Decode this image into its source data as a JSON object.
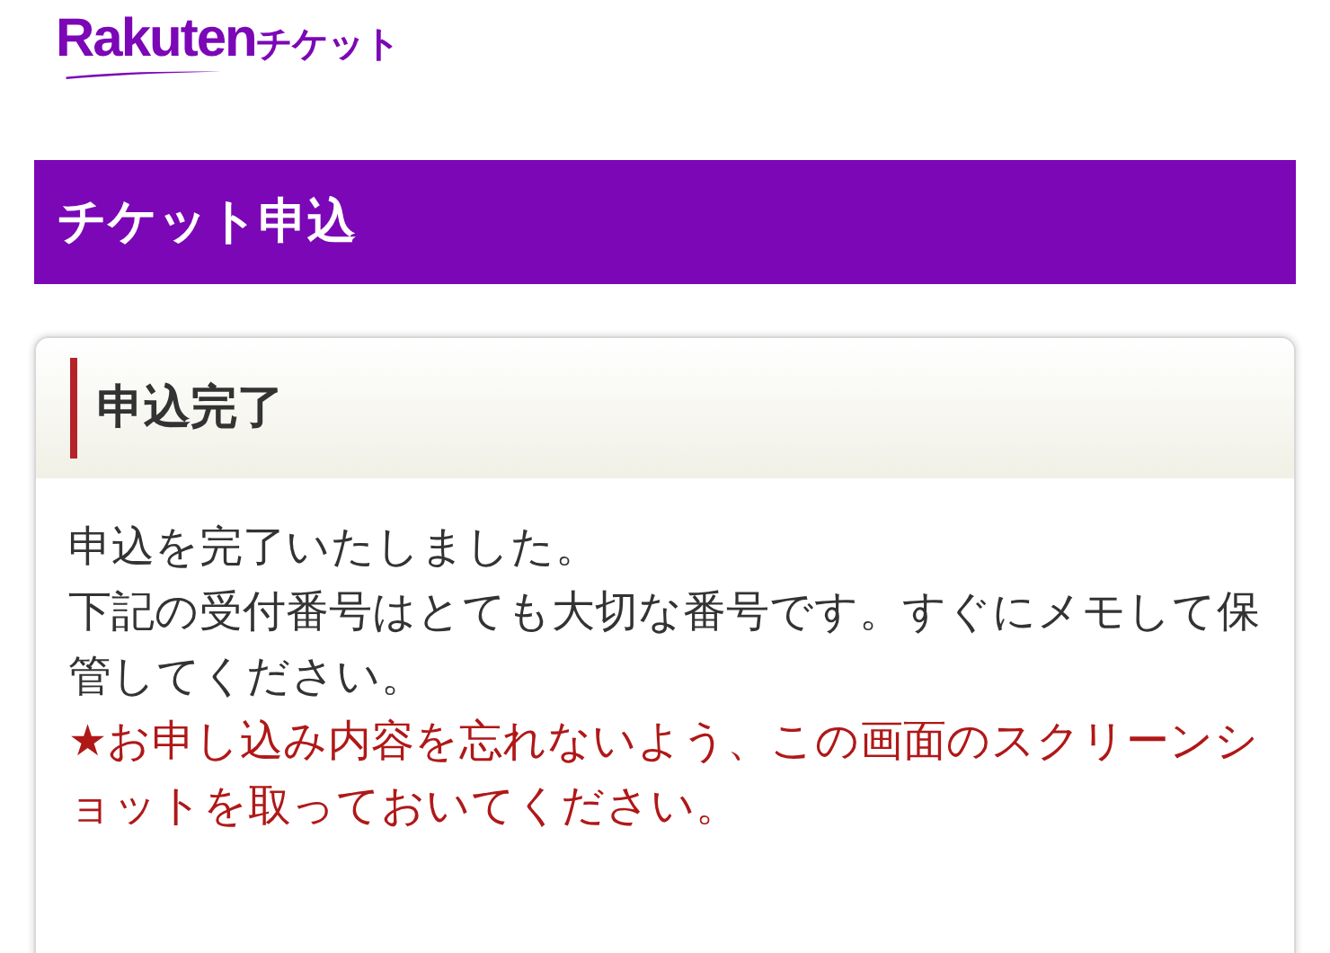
{
  "logo": {
    "brand": "Rakuten",
    "product": "チケット"
  },
  "page_title": "チケット申込",
  "card": {
    "title": "申込完了",
    "paragraphs": [
      {
        "kind": "normal",
        "text": "申込を完了いたしました。"
      },
      {
        "kind": "normal",
        "text": "下記の受付番号はとても大切な番号です。すぐにメモして保管してください。"
      },
      {
        "kind": "warning",
        "text": "★お申し込み内容を忘れないよう、この画面のスクリーンショットを取っておいてください。"
      }
    ]
  }
}
